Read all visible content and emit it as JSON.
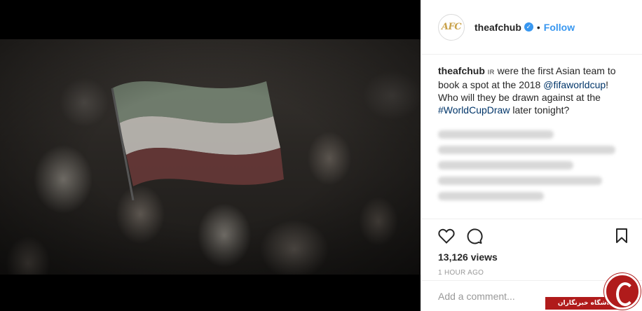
{
  "post": {
    "image_alt": "Crowd of fans waving a flag in a stadium",
    "header": {
      "avatar_text": "AFC",
      "username": "theafchub",
      "verified_icon": "verified-check-icon",
      "separator": "•",
      "follow_label": "Follow"
    },
    "caption": {
      "username": "theafchub",
      "country_code": "IR",
      "text_1": " were the first Asian team to book a spot at the 2018 ",
      "mention": "@fifaworldcup",
      "text_2": "! Who will they be drawn against at the ",
      "hashtag": "#WorldCupDraw",
      "text_3": " later tonight?"
    },
    "actions": {
      "like_icon": "heart-icon",
      "comment_icon": "comment-icon",
      "save_icon": "bookmark-icon"
    },
    "views": "13,126 views",
    "timestamp": "1 HOUR AGO",
    "comment_input": {
      "placeholder": "Add a comment..."
    }
  },
  "watermark": {
    "text": "باشگاه خبرنگاران",
    "brand_color": "#b01b1b"
  },
  "colors": {
    "link": "#3897f0",
    "mention": "#003569",
    "text": "#262626",
    "muted": "#999999"
  }
}
